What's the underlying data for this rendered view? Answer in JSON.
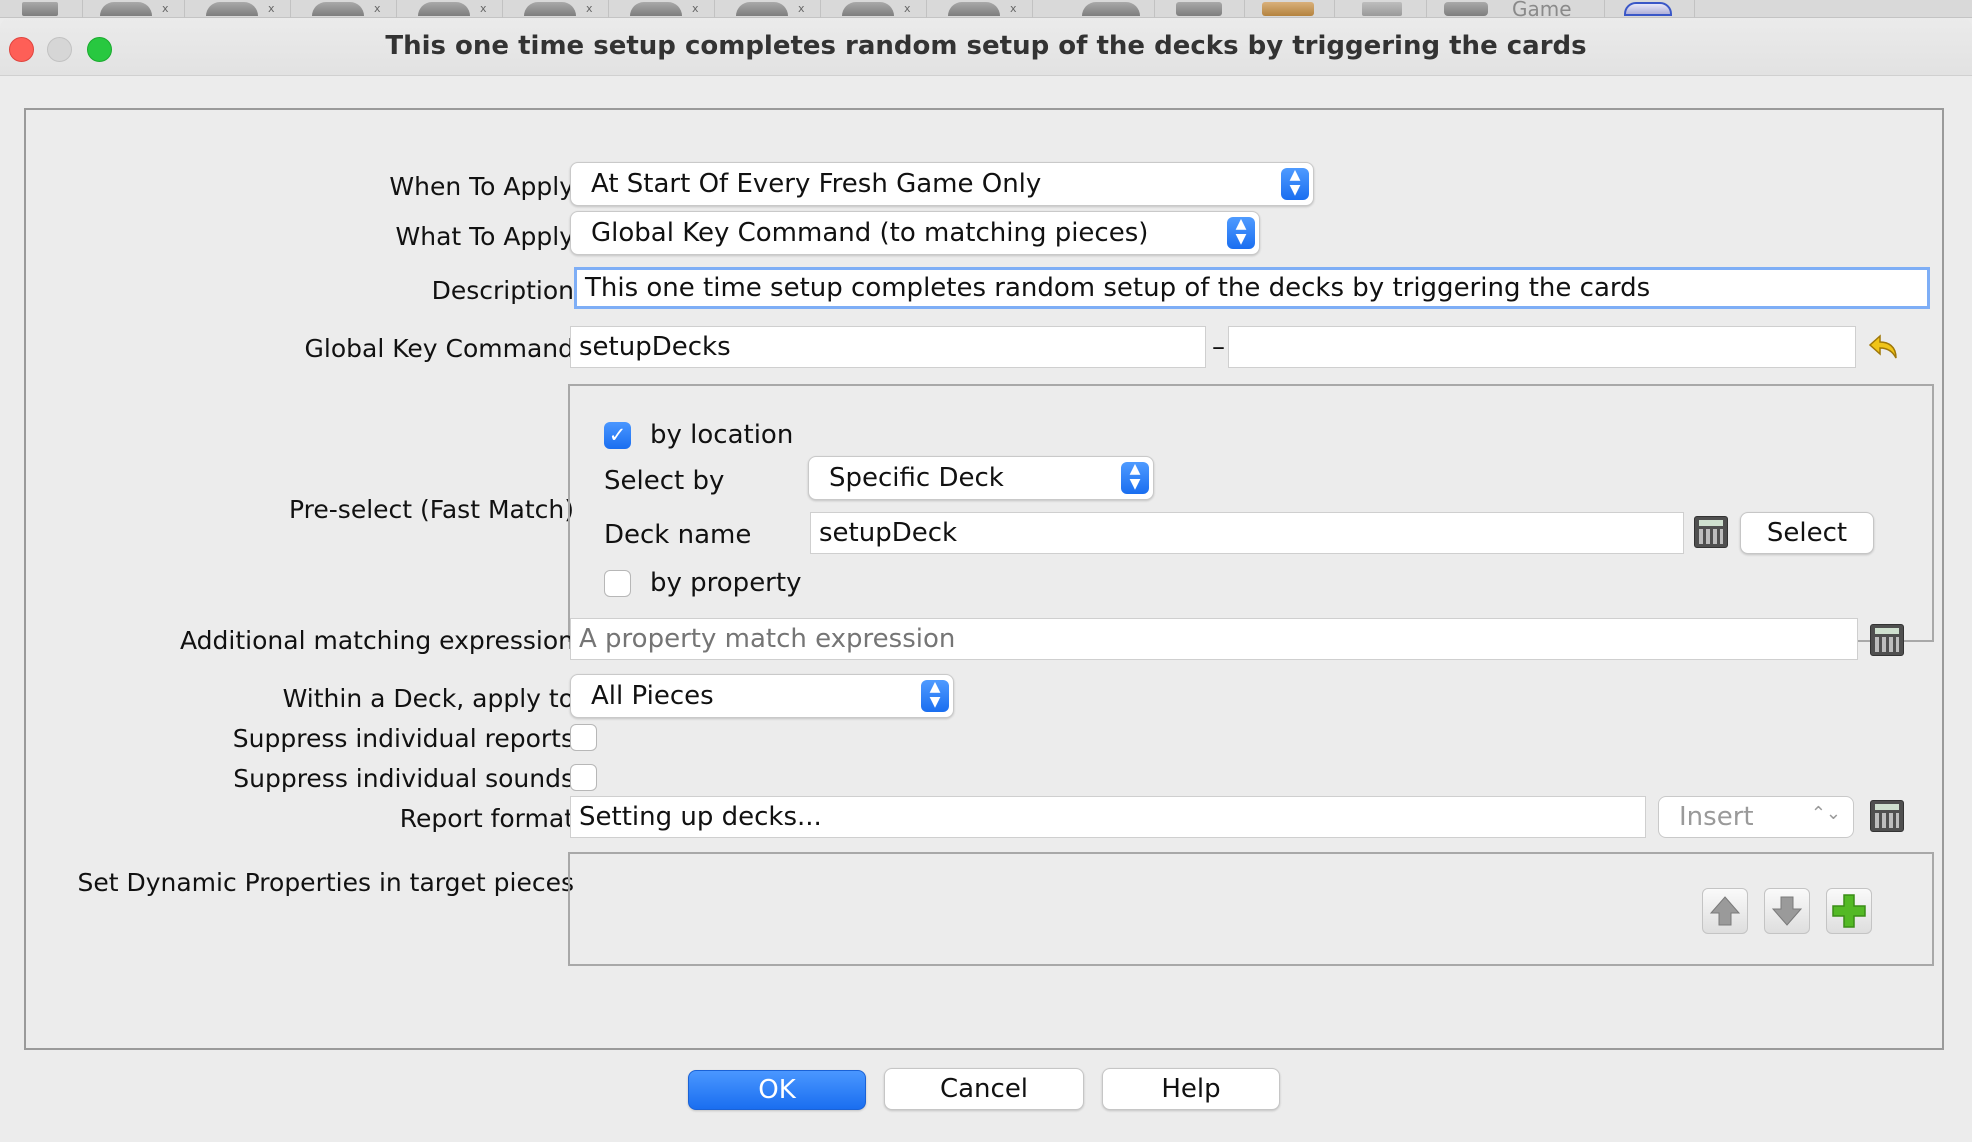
{
  "background_toolbar": {
    "button_count": 10,
    "close_mark": "x",
    "label": "Game"
  },
  "window": {
    "title": "This one time setup completes  random setup of the decks by triggering the cards"
  },
  "form": {
    "when_to_apply": {
      "label": "When To Apply",
      "value": "At Start Of Every Fresh Game Only"
    },
    "what_to_apply": {
      "label": "What To Apply",
      "value": "Global Key Command (to matching pieces)"
    },
    "description": {
      "label": "Description",
      "value": "This one time setup completes  random setup of the decks by triggering the cards"
    },
    "global_key_command": {
      "label": "Global Key Command",
      "value": "setupDecks",
      "separator": "–",
      "key_value": ""
    },
    "preselect": {
      "label": "Pre-select (Fast Match)",
      "by_location_label": "by location",
      "by_location_checked": true,
      "select_by_label": "Select by",
      "select_by_value": "Specific Deck",
      "deck_name_label": "Deck name",
      "deck_name_value": "setupDeck",
      "select_button": "Select",
      "by_property_label": "by property",
      "by_property_checked": false
    },
    "additional_expression": {
      "label": "Additional matching expression",
      "placeholder": "A property match expression"
    },
    "within_deck": {
      "label": "Within a Deck, apply to",
      "value": "All Pieces"
    },
    "suppress_reports": {
      "label": "Suppress individual reports",
      "checked": false
    },
    "suppress_sounds": {
      "label": "Suppress individual sounds",
      "checked": false
    },
    "report_format": {
      "label": "Report format",
      "value": "Setting up decks...",
      "insert_label": "Insert"
    },
    "dynamic_properties": {
      "label": "Set Dynamic Properties in target pieces"
    }
  },
  "buttons": {
    "ok": "OK",
    "cancel": "Cancel",
    "help": "Help"
  },
  "colors": {
    "accent": "#1a6ef0",
    "close": "#fe5f57",
    "minimize": "#d6d6d6",
    "zoom": "#28c840",
    "add": "#53b925"
  },
  "icons": {
    "checkbox_checked": "✓",
    "stepper_up": "▲",
    "stepper_down": "▼",
    "insert_stepper": "⌃⌄"
  }
}
